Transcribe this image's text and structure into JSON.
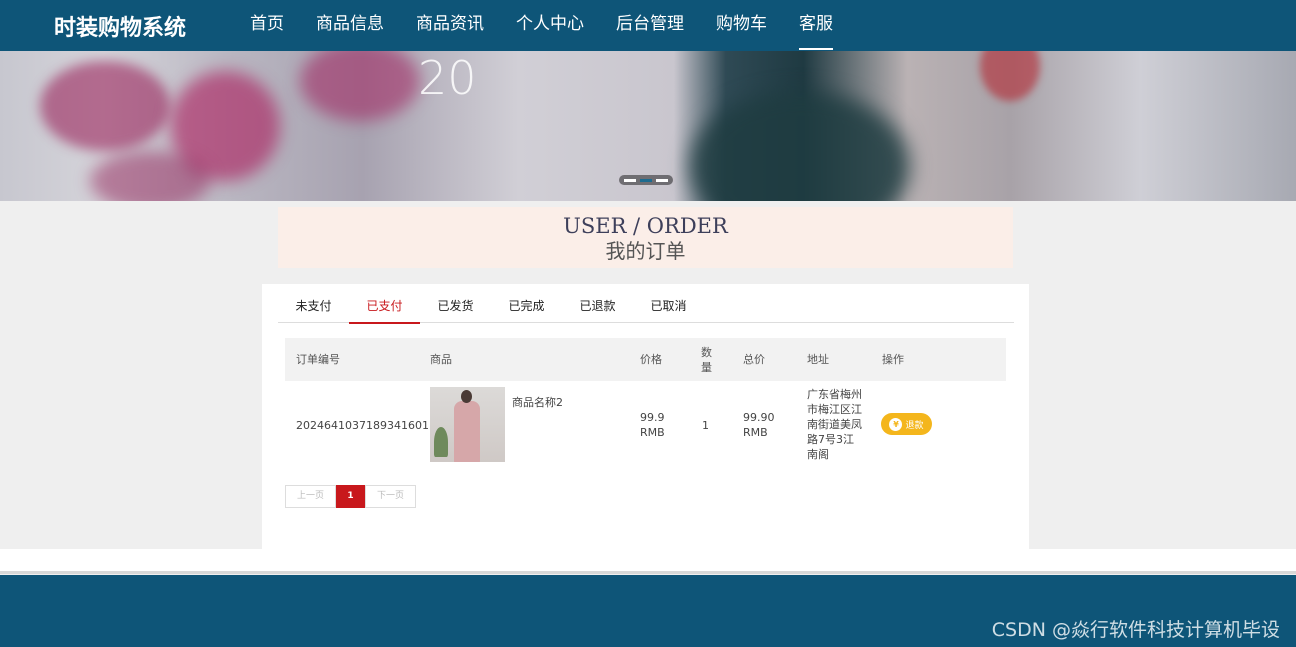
{
  "header": {
    "brand": "时装购物系统",
    "nav": [
      "首页",
      "商品信息",
      "商品资讯",
      "个人中心",
      "后台管理",
      "购物车",
      "客服"
    ],
    "active_nav": "客服"
  },
  "banner": {
    "year_text": "20"
  },
  "section": {
    "title_en": "USER / ORDER",
    "title_cn": "我的订单"
  },
  "tabs": {
    "items": [
      "未支付",
      "已支付",
      "已发货",
      "已完成",
      "已退款",
      "已取消"
    ],
    "active": "已支付"
  },
  "table": {
    "headers": {
      "order_no": "订单编号",
      "product": "商品",
      "price": "价格",
      "qty": "数量",
      "total": "总价",
      "address": "地址",
      "action": "操作"
    },
    "rows": [
      {
        "order_no": "2024641037189341601",
        "product_name": "商品名称2",
        "price": "99.9 RMB",
        "qty": "1",
        "total": "99.90 RMB",
        "address": "广东省梅州市梅江区江南街道美凤路7号3江南阁",
        "action": "退款",
        "action_icon": "¥"
      }
    ]
  },
  "pager": {
    "prev": "上一页",
    "current": "1",
    "next": "下一页"
  },
  "footer": {
    "watermark": "CSDN @焱行软件科技计算机毕设"
  },
  "colors": {
    "primary": "#0e5578",
    "accent_red": "#c8181c",
    "refund_yellow": "#f4b61c",
    "title_bg": "#fbeee8"
  }
}
